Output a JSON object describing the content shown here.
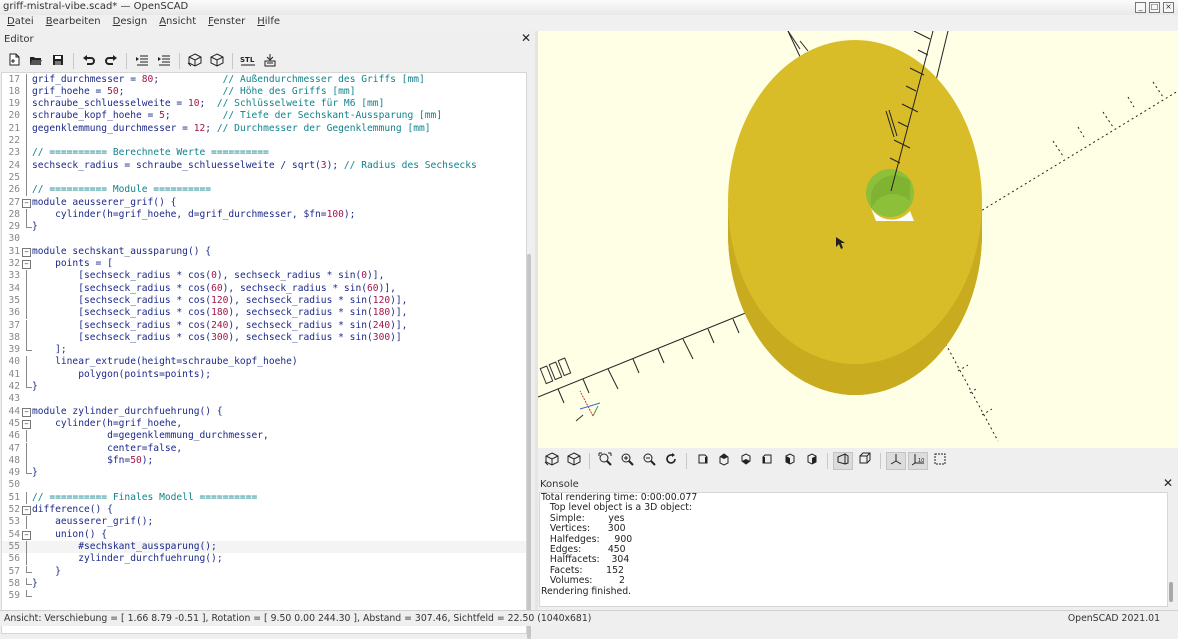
{
  "window": {
    "title": "griff-mistral-vibe.scad* — OpenSCAD"
  },
  "menu": [
    {
      "first": "D",
      "rest": "atei"
    },
    {
      "first": "B",
      "rest": "earbeiten"
    },
    {
      "first": "D",
      "rest": "esign"
    },
    {
      "first": "A",
      "rest": "nsicht"
    },
    {
      "first": "F",
      "rest": "enster"
    },
    {
      "first": "H",
      "rest": "ilfe"
    }
  ],
  "editor": {
    "title": "Editor",
    "toolbar_icons": [
      "new-file-icon",
      "open-file-icon",
      "save-icon",
      "undo-icon",
      "redo-icon",
      "unindent-icon",
      "indent-icon",
      "preview-icon",
      "render-icon",
      "export-stl-icon",
      "send-to-print-icon"
    ],
    "lines": [
      {
        "n": "17",
        "fold": "line",
        "t": "grif_durchmesser = 80;           // Außendurchmesser des Griffs [mm]"
      },
      {
        "n": "18",
        "fold": "line",
        "t": "grif_hoehe = 50;                 // Höhe des Griffs [mm]"
      },
      {
        "n": "19",
        "fold": "line",
        "t": "schraube_schluesselweite = 10;  // Schlüsselweite für M6 [mm]"
      },
      {
        "n": "20",
        "fold": "line",
        "t": "schraube_kopf_hoehe = 5;         // Tiefe der Sechskant-Aussparung [mm]"
      },
      {
        "n": "21",
        "fold": "line",
        "t": "gegenklemmung_durchmesser = 12; // Durchmesser der Gegenklemmung [mm]"
      },
      {
        "n": "22",
        "fold": "line",
        "t": ""
      },
      {
        "n": "23",
        "fold": "line",
        "t": "// ========== Berechnete Werte =========="
      },
      {
        "n": "24",
        "fold": "line",
        "t": "sechseck_radius = schraube_schluesselweite / sqrt(3); // Radius des Sechsecks"
      },
      {
        "n": "25",
        "fold": "line",
        "t": ""
      },
      {
        "n": "26",
        "fold": "line",
        "t": "// ========== Module =========="
      },
      {
        "n": "27",
        "fold": "open",
        "t": "module aeusserer_grif() {"
      },
      {
        "n": "28",
        "fold": "line",
        "t": "    cylinder(h=grif_hoehe, d=grif_durchmesser, $fn=100);"
      },
      {
        "n": "29",
        "fold": "end",
        "t": "}"
      },
      {
        "n": "30",
        "fold": "",
        "t": ""
      },
      {
        "n": "31",
        "fold": "open",
        "t": "module sechskant_aussparung() {"
      },
      {
        "n": "32",
        "fold": "open",
        "t": "    points = ["
      },
      {
        "n": "33",
        "fold": "line",
        "t": "        [sechseck_radius * cos(0), sechseck_radius * sin(0)],"
      },
      {
        "n": "34",
        "fold": "line",
        "t": "        [sechseck_radius * cos(60), sechseck_radius * sin(60)],"
      },
      {
        "n": "35",
        "fold": "line",
        "t": "        [sechseck_radius * cos(120), sechseck_radius * sin(120)],"
      },
      {
        "n": "36",
        "fold": "line",
        "t": "        [sechseck_radius * cos(180), sechseck_radius * sin(180)],"
      },
      {
        "n": "37",
        "fold": "line",
        "t": "        [sechseck_radius * cos(240), sechseck_radius * sin(240)],"
      },
      {
        "n": "38",
        "fold": "line",
        "t": "        [sechseck_radius * cos(300), sechseck_radius * sin(300)]"
      },
      {
        "n": "39",
        "fold": "end",
        "t": "    ];"
      },
      {
        "n": "40",
        "fold": "line",
        "t": "    linear_extrude(height=schraube_kopf_hoehe)"
      },
      {
        "n": "41",
        "fold": "line",
        "t": "        polygon(points=points);"
      },
      {
        "n": "42",
        "fold": "end",
        "t": "}"
      },
      {
        "n": "43",
        "fold": "",
        "t": ""
      },
      {
        "n": "44",
        "fold": "open",
        "t": "module zylinder_durchfuehrung() {"
      },
      {
        "n": "45",
        "fold": "open",
        "t": "    cylinder(h=grif_hoehe,"
      },
      {
        "n": "46",
        "fold": "line",
        "t": "             d=gegenklemmung_durchmesser,"
      },
      {
        "n": "47",
        "fold": "line",
        "t": "             center=false,"
      },
      {
        "n": "48",
        "fold": "line",
        "t": "             $fn=50);"
      },
      {
        "n": "49",
        "fold": "end",
        "t": "}"
      },
      {
        "n": "50",
        "fold": "",
        "t": ""
      },
      {
        "n": "51",
        "fold": "line",
        "t": "// ========== Finales Modell =========="
      },
      {
        "n": "52",
        "fold": "open",
        "t": "difference() {"
      },
      {
        "n": "53",
        "fold": "line",
        "t": "    aeusserer_grif();"
      },
      {
        "n": "54",
        "fold": "open",
        "t": "    union() {"
      },
      {
        "n": "55",
        "fold": "line",
        "t": "        #sechskant_aussparung();"
      },
      {
        "n": "56",
        "fold": "line",
        "t": "        zylinder_durchfuehrung();"
      },
      {
        "n": "57",
        "fold": "end",
        "t": "    }"
      },
      {
        "n": "58",
        "fold": "end",
        "t": "}"
      },
      {
        "n": "59",
        "fold": "end",
        "t": ""
      }
    ]
  },
  "viewport": {
    "background": "#ffffe6",
    "model_color": "#d9bd28",
    "model_side_color": "#c9ab20",
    "hole_color": "#8cbf3a",
    "toolbar_icons": [
      "preview-icon",
      "render-icon",
      "zoom-all-icon",
      "zoom-in-icon",
      "zoom-out-icon",
      "reset-view-icon",
      "view-right-icon",
      "view-top-icon",
      "view-bottom-icon",
      "view-left-icon",
      "view-front-icon",
      "view-back-icon",
      "perspective-icon",
      "orthogonal-icon",
      "show-axes-icon",
      "show-scale-icon",
      "show-edges-icon"
    ]
  },
  "console": {
    "title": "Konsole",
    "lines": [
      "Total rendering time: 0:00:00.077",
      "   Top level object is a 3D object:",
      "   Simple:        yes",
      "   Vertices:      300",
      "   Halfedges:     900",
      "   Edges:         450",
      "   Halffacets:    304",
      "   Facets:        152",
      "   Volumes:         2",
      "Rendering finished."
    ]
  },
  "status": {
    "left": "Ansicht: Verschiebung = [ 1.66 8.79 -0.51 ], Rotation = [ 9.50 0.00 244.30 ], Abstand = 307.46, Sichtfeld = 22.50 (1040x681)",
    "right": "OpenSCAD 2021.01"
  }
}
